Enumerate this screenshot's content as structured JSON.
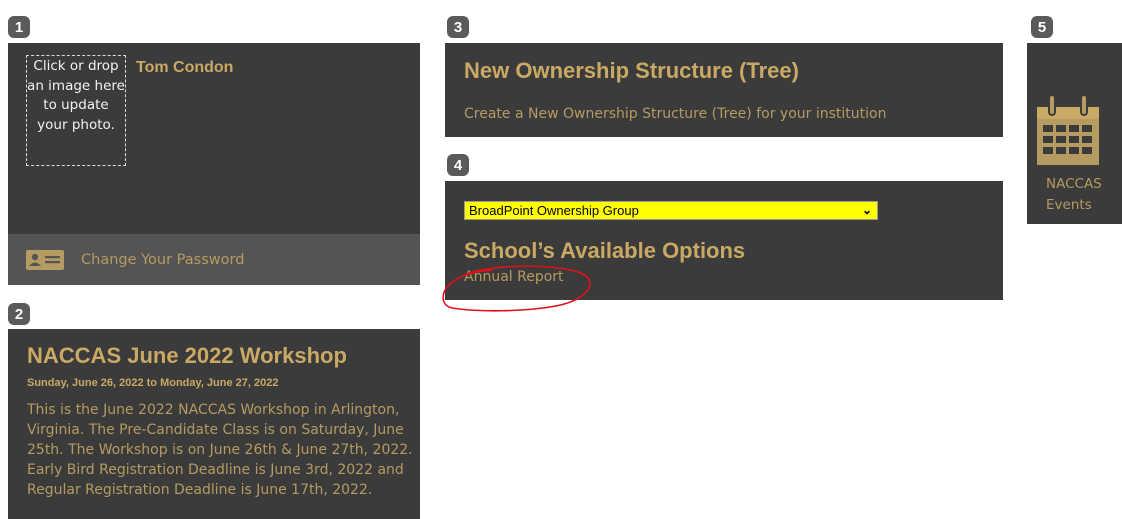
{
  "badges": [
    "1",
    "2",
    "3",
    "4",
    "5"
  ],
  "profile": {
    "photo_hint": "Click or drop an image here to update your photo.",
    "user_name": "Tom Condon",
    "change_password_label": "Change Your Password"
  },
  "workshop": {
    "title": "NACCAS June 2022 Workshop",
    "date_range": "Sunday, June 26, 2022 to Monday, June 27, 2022",
    "description": "This is the June 2022 NACCAS Workshop in Arlington, Virginia. The Pre-Candidate Class is on Saturday, June 25th. The Workshop is on June 26th & June 27th, 2022. Early Bird Registration Deadline is June 3rd, 2022 and Regular Registration Deadline is June 17th, 2022."
  },
  "ownership": {
    "title": "New Ownership Structure (Tree)",
    "description": "Create a New Ownership Structure (Tree) for your institution"
  },
  "options": {
    "selected_group": "BroadPoint Ownership Group",
    "title": "School’s Available Options",
    "link_label": "Annual Report"
  },
  "events": {
    "label": "NACCAS Events",
    "icon": "calendar-icon"
  },
  "colors": {
    "panel_bg": "#3c3b3b",
    "accent_gold": "#c9a964",
    "text_gold": "#b59a61",
    "select_bg": "#ffff00",
    "annotation_red": "#e0101a"
  }
}
